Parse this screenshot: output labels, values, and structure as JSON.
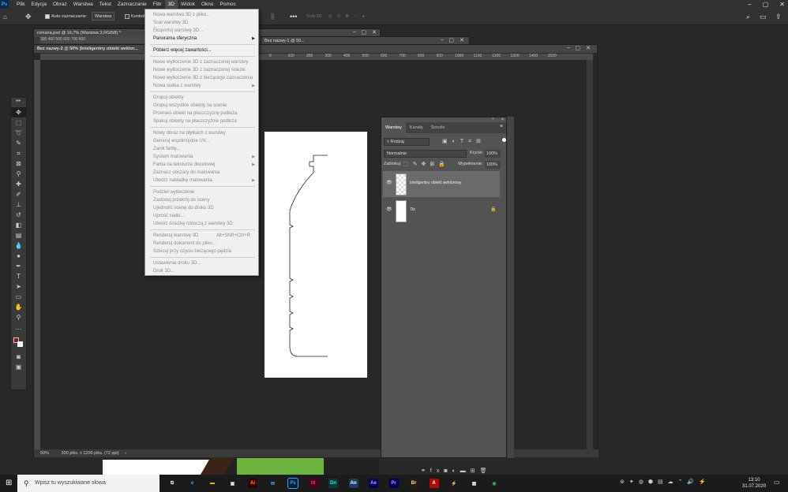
{
  "menubar": {
    "items": [
      "Plik",
      "Edycja",
      "Obraz",
      "Warstwa",
      "Tekst",
      "Zaznaczanie",
      "Filtr",
      "3D",
      "Widok",
      "Okno",
      "Pomoc"
    ],
    "active": "3D"
  },
  "options": {
    "auto_select_label": "Auto-zaznaczanie:",
    "auto_select_value": "Warstwa",
    "controls_label": "Kontrol",
    "mode_3d_label": "Tryb 3D:"
  },
  "doc1": {
    "title": "romana.psd @ 16,7% (Warstwa 3,RGB/8) *",
    "ruler": "300   400   500   600   700   800"
  },
  "doc3": {
    "title": "Bez nazwy-1 @ 50..."
  },
  "doc2": {
    "title": "Bez nazwy-2 @ 50% (Inteligentny obiekt wektor...",
    "ruler": [
      "0",
      "100",
      "200",
      "300",
      "400",
      "500",
      "600",
      "700",
      "800",
      "900",
      "1000",
      "1100",
      "1200",
      "1300",
      "1400",
      "1500"
    ],
    "zoom": "50%",
    "doc_size": "300 piks. x 1200 piks. (72 ppi)"
  },
  "menu3d": {
    "items": [
      {
        "label": "Nowa warstwa 3D z pliku...",
        "enabled": false
      },
      {
        "label": "Scal warstwy 3D",
        "enabled": false
      },
      {
        "label": "Eksportuj warstwę 3D...",
        "enabled": false
      },
      {
        "label": "Panorama sferyczna",
        "enabled": true,
        "submenu": true
      },
      {
        "sep": true
      },
      {
        "label": "Pobierz więcej zawartości...",
        "enabled": true
      },
      {
        "sep": true
      },
      {
        "label": "Nowe wytłoczenie 3D z zaznaczonej warstwy",
        "enabled": false
      },
      {
        "label": "Nowe wytłoczenie 3D z zaznaczonej ścieżki",
        "enabled": false
      },
      {
        "label": "Nowe wytłoczenie 3D z bieżącego zaznaczenia",
        "enabled": false
      },
      {
        "label": "Nowa siatka z warstwy",
        "enabled": false,
        "submenu": true
      },
      {
        "sep": true
      },
      {
        "label": "Grupuj obiekty",
        "enabled": false
      },
      {
        "label": "Grupuj wszystkie obiekty na scenie",
        "enabled": false
      },
      {
        "label": "Przenieś obiekt na płaszczyznę podłoża",
        "enabled": false
      },
      {
        "label": "Spakuj obiekty na płaszczyźnie podłoża",
        "enabled": false
      },
      {
        "sep": true
      },
      {
        "label": "Nowy obraz na płytkach z warstwy",
        "enabled": false
      },
      {
        "label": "Generuj współrzędne UV...",
        "enabled": false
      },
      {
        "label": "Zanik farby...",
        "enabled": false
      },
      {
        "label": "System malowania",
        "enabled": false,
        "submenu": true
      },
      {
        "label": "Farba na teksturze docelowej",
        "enabled": false,
        "submenu": true
      },
      {
        "label": "Zaznacz obszary do malowania",
        "enabled": false
      },
      {
        "label": "Utwórz nakładkę malowania",
        "enabled": false,
        "submenu": true
      },
      {
        "sep": true
      },
      {
        "label": "Podziel wytłoczenie",
        "enabled": false
      },
      {
        "label": "Zastosuj przekrój do sceny",
        "enabled": false
      },
      {
        "label": "Ujednolić scenę do druku 3D",
        "enabled": false
      },
      {
        "label": "Uprość siatki...",
        "enabled": false
      },
      {
        "label": "Utwórz ścieżkę roboczą z warstwy 3D",
        "enabled": false
      },
      {
        "sep": true
      },
      {
        "label": "Renderuj warstwę 3D",
        "enabled": false,
        "shortcut": "Alt+Shift+Ctrl+R"
      },
      {
        "label": "Renderuj dokument do pliku...",
        "enabled": false
      },
      {
        "label": "Szkicuj przy użyciu bieżącego pędzla",
        "enabled": false
      },
      {
        "sep": true
      },
      {
        "label": "Ustawienia druku 3D...",
        "enabled": false
      },
      {
        "label": "Druk 3D...",
        "enabled": false
      }
    ]
  },
  "layers_panel": {
    "tabs": [
      "Warstwy",
      "Kanały",
      "Ścieżki"
    ],
    "filter": "Rodzaj",
    "blend_mode": "Normalnie",
    "opacity_label": "Krycie:",
    "opacity": "100%",
    "lock_label": "Zablokuj:",
    "fill_label": "Wypełnienie:",
    "fill": "100%",
    "layers": [
      "Inteligentny obiekt wektorowy",
      "Tło"
    ]
  },
  "taskbar": {
    "search_placeholder": "Wpisz tu wyszukiwane słowa",
    "time": "13:10",
    "date": "31.07.2020",
    "apps": [
      {
        "name": "task-view",
        "glyph": "⧉",
        "color": "#ddd",
        "bg": "transparent"
      },
      {
        "name": "edge",
        "glyph": "e",
        "color": "#3fa9f5",
        "bg": "transparent"
      },
      {
        "name": "explorer",
        "glyph": "▬",
        "color": "#f5c400",
        "bg": "transparent"
      },
      {
        "name": "store",
        "glyph": "▣",
        "color": "#ddd",
        "bg": "transparent"
      },
      {
        "name": "illustrator",
        "glyph": "Ai",
        "color": "#ff9a00",
        "bg": "#330000"
      },
      {
        "name": "mail",
        "glyph": "✉",
        "color": "#3fa9f5",
        "bg": "transparent"
      },
      {
        "name": "photoshop",
        "glyph": "Ps",
        "color": "#31a8ff",
        "bg": "#001e36"
      },
      {
        "name": "indesign",
        "glyph": "Id",
        "color": "#ff3366",
        "bg": "#49021f"
      },
      {
        "name": "dimension",
        "glyph": "Dn",
        "color": "#3ee6c1",
        "bg": "#0a3a3a"
      },
      {
        "name": "animate",
        "glyph": "An",
        "color": "#fff",
        "bg": "#1d3a63"
      },
      {
        "name": "after-effects",
        "glyph": "Ae",
        "color": "#d291ff",
        "bg": "#00005b"
      },
      {
        "name": "premiere",
        "glyph": "Pr",
        "color": "#d291ff",
        "bg": "#00005b"
      },
      {
        "name": "bridge",
        "glyph": "Br",
        "color": "#ddd",
        "bg": "#2a1a0a"
      },
      {
        "name": "acrobat",
        "glyph": "A",
        "color": "#fff",
        "bg": "#b30b00"
      },
      {
        "name": "flash",
        "glyph": "⚡",
        "color": "#ff9a00",
        "bg": "transparent"
      },
      {
        "name": "calculator",
        "glyph": "▦",
        "color": "#ddd",
        "bg": "transparent"
      },
      {
        "name": "chrome",
        "glyph": "◉",
        "color": "#34a853",
        "bg": "transparent"
      }
    ]
  }
}
